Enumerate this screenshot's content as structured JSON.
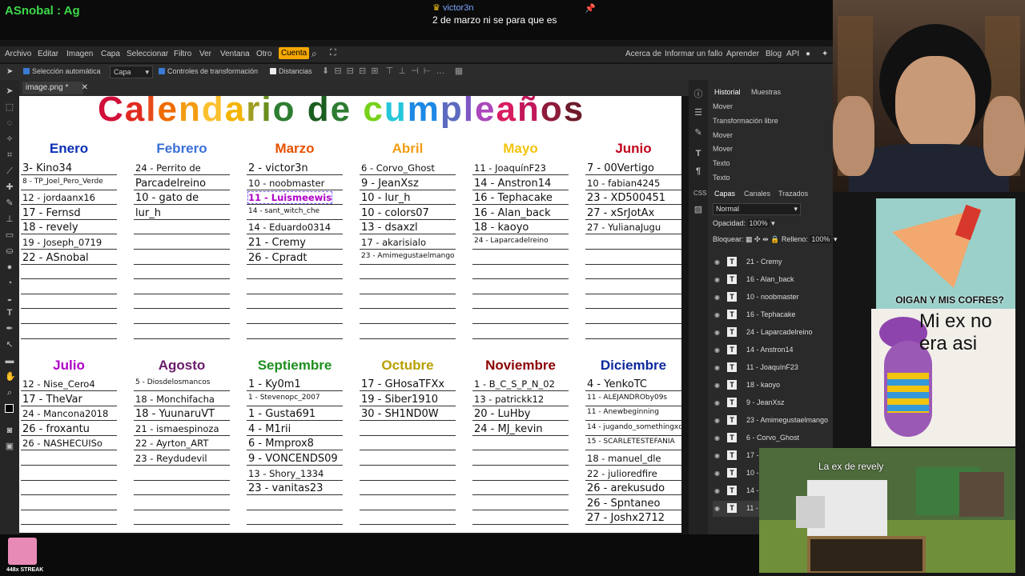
{
  "stream": {
    "streamer": "ASnobal : Ag",
    "chat_user": "victor3n",
    "chat_message": "2 de marzo ni se para que es",
    "streak": "448x STREAK"
  },
  "menu": [
    "Archivo",
    "Editar",
    "Imagen",
    "Capa",
    "Seleccionar",
    "Filtro",
    "Ver",
    "Ventana",
    "Otro",
    "Cuenta"
  ],
  "menu_right": [
    "Acerca de",
    "Informar un fallo",
    "Aprender",
    "Blog",
    "API"
  ],
  "toolbar": {
    "auto_select": "Selección automática",
    "layer_select": "Capa",
    "transform_controls": "Controles de transformación",
    "distances": "Distancias"
  },
  "document_tab": "image.png *",
  "calendar": {
    "title_letters": [
      {
        "ch": "C",
        "color": "#d0103a"
      },
      {
        "ch": "a",
        "color": "#e02a20"
      },
      {
        "ch": "l",
        "color": "#e64a19"
      },
      {
        "ch": "e",
        "color": "#ef6c00"
      },
      {
        "ch": "n",
        "color": "#f39c12"
      },
      {
        "ch": "d",
        "color": "#fbc02d"
      },
      {
        "ch": "a",
        "color": "#f4b400"
      },
      {
        "ch": "r",
        "color": "#9e9d24"
      },
      {
        "ch": "i",
        "color": "#6a8f1f"
      },
      {
        "ch": "o",
        "color": "#2e7d32"
      },
      {
        "ch": " ",
        "color": "#000000"
      },
      {
        "ch": "d",
        "color": "#1b5e20"
      },
      {
        "ch": "e",
        "color": "#2e7d32"
      },
      {
        "ch": " ",
        "color": "#000000"
      },
      {
        "ch": "c",
        "color": "#76d11a"
      },
      {
        "ch": "u",
        "color": "#26c6da"
      },
      {
        "ch": "m",
        "color": "#1e88e5"
      },
      {
        "ch": "p",
        "color": "#5c6bc0"
      },
      {
        "ch": "l",
        "color": "#7e57c2"
      },
      {
        "ch": "e",
        "color": "#ab47bc"
      },
      {
        "ch": "a",
        "color": "#d81b60"
      },
      {
        "ch": "ñ",
        "color": "#c2185b"
      },
      {
        "ch": "o",
        "color": "#8e1b3b"
      },
      {
        "ch": "s",
        "color": "#6d1b2b"
      }
    ],
    "months_top": [
      {
        "name": "Enero",
        "color": "#0b2fb5",
        "entries": [
          "3- Kino34",
          "8 - TP_Joel_Pero_Verde",
          "12 - jordaanx16",
          "17 - Fernsd",
          "18 - revely",
          "19 - Joseph_0719",
          "22 - ASnobal"
        ]
      },
      {
        "name": "Febrero",
        "color": "#3a6fd8",
        "entries": [
          "24 - Perrito de",
          "Parcadelreino",
          "10 - gato de",
          "lur_h"
        ]
      },
      {
        "name": "Marzo",
        "color": "#e65100",
        "entries": [
          "2 - victor3n",
          "10 - noobmaster",
          "11 - Luismeewis",
          "14 - sant_witch_che",
          "14 - Eduardo0314",
          "21 - Cremy",
          "26 - Cpradt"
        ]
      },
      {
        "name": "Abril",
        "color": "#f39c12",
        "entries": [
          "6 - Corvo_Ghost",
          "9 - JeanXsz",
          "10 - lur_h",
          "10 - colors07",
          "13 - dsaxzl",
          "17 - akarisialo",
          "23 - Amimegustaelmango"
        ]
      },
      {
        "name": "Mayo",
        "color": "#f1c40f",
        "entries": [
          "11 - JoaquínF23",
          "14 - Anstron14",
          "16 - Tephacake",
          "16 - Alan_back",
          "18 - kaoyo",
          "24 - Laparcadelreino"
        ]
      },
      {
        "name": "Junio",
        "color": "#c0001a",
        "entries": [
          "7 - 00Vertigo",
          "10 - fabian4245",
          "23 - XD500451",
          "27 - xSrJotAx",
          "27 - YulianaJugu"
        ]
      }
    ],
    "months_bottom": [
      {
        "name": "Julio",
        "color": "#b000c8",
        "entries": [
          "12 - Nise_Cero4",
          "17 - TheVar",
          "24 - Mancona2018",
          "26 - froxantu",
          "26 - NASHECUISo"
        ]
      },
      {
        "name": "Agosto",
        "color": "#6a1b6a",
        "entries": [
          "5 - Diosdelosmancos",
          "18 - Monchifacha",
          "18 - YuunaruVT",
          "21 - ismaespinoza",
          "22 - Ayrton_ART",
          "23 - Reydudevil"
        ]
      },
      {
        "name": "Septiembre",
        "color": "#1e8e1e",
        "entries": [
          "1 - Ky0m1",
          "1 - Stevenopc_2007",
          "1 - Gusta691",
          "4 - M1rii",
          "6 - Mmprox8",
          "9 - VONCENDS09",
          "13 - Shory_1334",
          "23 - vanitas23"
        ]
      },
      {
        "name": "Octubre",
        "color": "#b8a000",
        "entries": [
          "17 - GHosaTFXx",
          "19 - Siber1910",
          "30 - SH1ND0W"
        ]
      },
      {
        "name": "Noviembre",
        "color": "#8b0000",
        "entries": [
          "1 - B_C_S_P_N_02",
          "13 - patrickk12",
          "20 - LuHby",
          "24 - MJ_kevin"
        ]
      },
      {
        "name": "Diciembre",
        "color": "#0d2a9e",
        "entries": [
          "4 - YenkoTC",
          "11 - ALEJANDROby09s",
          "11 - Anewbeginning",
          "14 - jugando_somethingxd",
          "15 - SCARLETESTEFANIA",
          "18 - manuel_dle",
          "22 - julioredfire",
          "26 - arekusudo",
          "26 - Spntaneo",
          "27 - Joshx2712"
        ]
      }
    ]
  },
  "panels": {
    "history_tabs": [
      "Historial",
      "Muestras"
    ],
    "history": [
      "Mover",
      "Transformación libre",
      "Mover",
      "Mover",
      "Texto",
      "Texto"
    ],
    "layer_tabs": [
      "Capas",
      "Canales",
      "Trazados"
    ],
    "blend_mode": "Normal",
    "opacity_label": "Opacidad:",
    "opacity": "100%",
    "lock_label": "Bloquear:",
    "fill_label": "Relleno:",
    "fill": "100%",
    "layers": [
      "21 - Cremy",
      "16 - Alan_back",
      "10 - noobmaster",
      "16 - Tephacake",
      "24 - Laparcadelreino",
      "14 - Anstron14",
      "11 - JoaquínF23",
      "18 - kaoyo",
      "9 - JeanXsz",
      "23 - Amimegustaelmango",
      "6 - Corvo_Ghost",
      "17 -",
      "10 -",
      "14 -",
      "11 -"
    ]
  },
  "memes": {
    "meme1_caption": "OIGAN Y MIS COFRES?",
    "meme2_caption": "Mi ex no era asi",
    "meme3_caption": "La ex de revely"
  }
}
